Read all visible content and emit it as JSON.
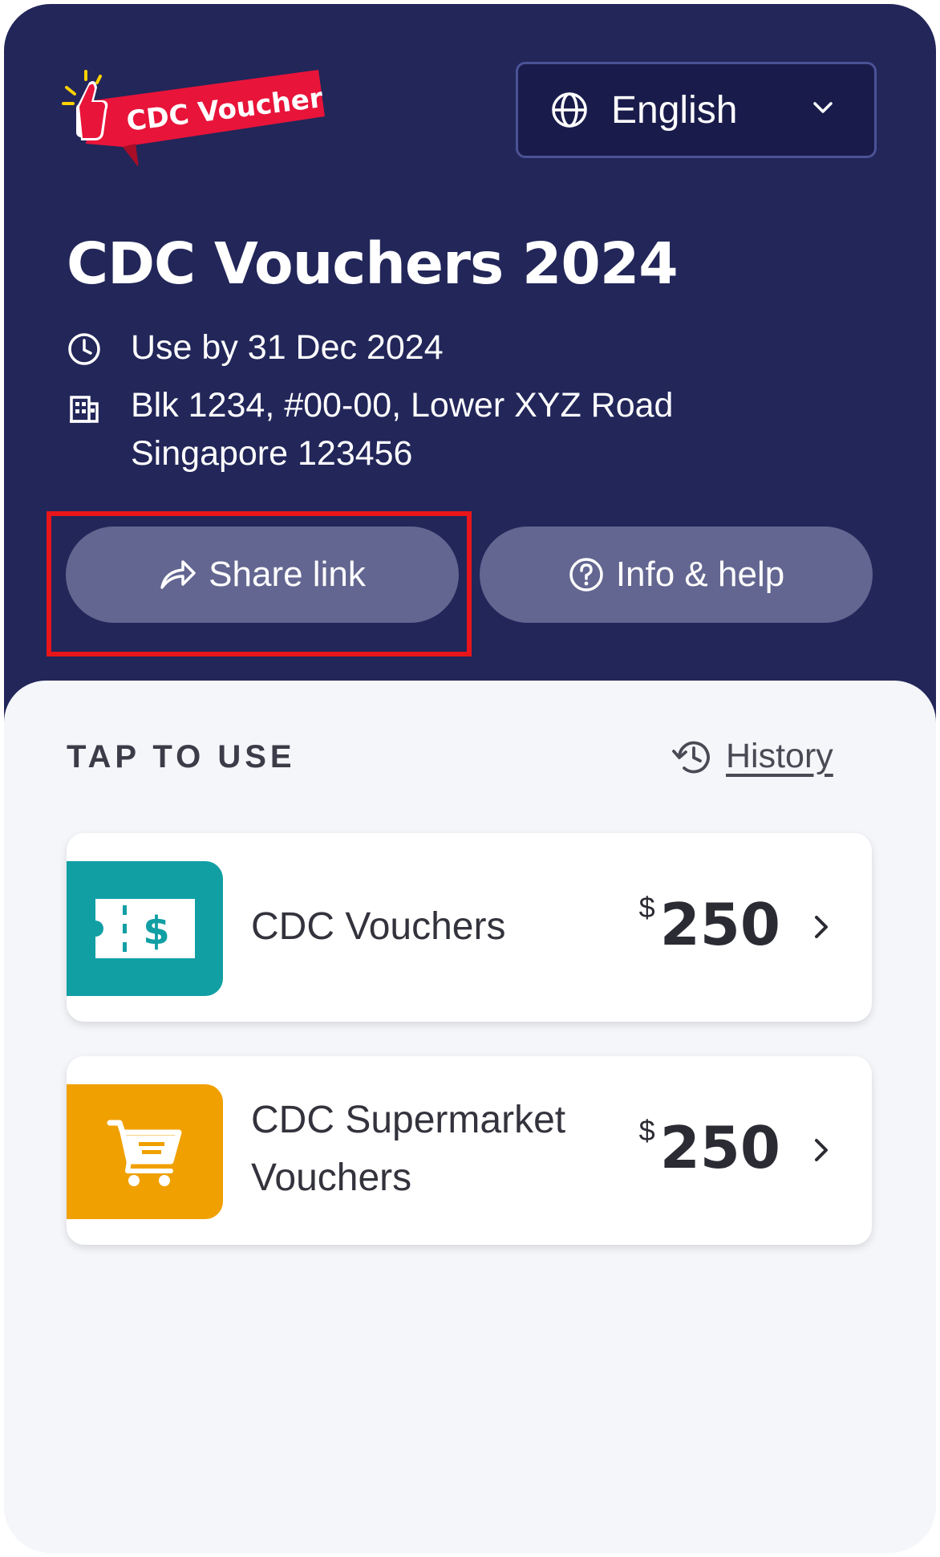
{
  "colors": {
    "header_bg": "#222659",
    "sheet_bg": "#f4f6fa",
    "pill_bg": "#636690",
    "logo_red": "#e8143a",
    "voucher_teal": "#119fa4",
    "supermarket_orange": "#f0a000",
    "highlight_red": "#e8151b"
  },
  "header": {
    "logo_text": "CDC Voucher",
    "language": {
      "selected": "English",
      "icon": "globe-icon"
    },
    "title": "CDC Vouchers 2024",
    "expiry": {
      "icon": "clock-icon",
      "text": "Use by 31 Dec 2024"
    },
    "address": {
      "icon": "building-icon",
      "line1": "Blk 1234, #00-00, Lower XYZ Road",
      "line2": "Singapore 123456"
    },
    "share_button": {
      "label": "Share link",
      "icon": "share-arrow-icon"
    },
    "help_button": {
      "label": "Info & help",
      "icon": "question-circle-icon"
    }
  },
  "vouchers": {
    "section_label": "TAP TO USE",
    "history_label": "History",
    "items": [
      {
        "name": "CDC Vouchers",
        "currency": "$",
        "amount": "250",
        "icon": "voucher-ticket-icon"
      },
      {
        "name_line1": "CDC Supermarket",
        "name_line2": "Vouchers",
        "currency": "$",
        "amount": "250",
        "icon": "shopping-cart-icon"
      }
    ]
  }
}
